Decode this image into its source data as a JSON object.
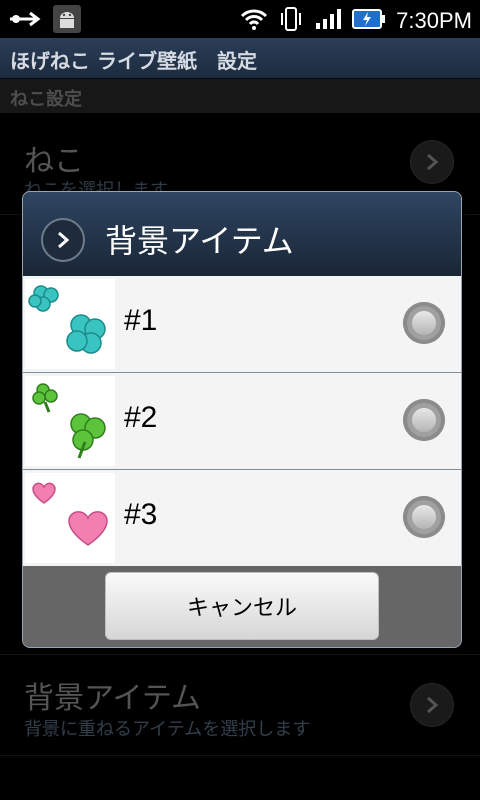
{
  "status_bar": {
    "time": "7:30PM",
    "icons": [
      "usb-icon",
      "android-icon",
      "wifi-icon",
      "vibrate-icon",
      "signal-icon",
      "battery-charging-icon"
    ]
  },
  "app": {
    "title": "ほげねこ ライブ壁紙　設定"
  },
  "section": {
    "header": "ねこ設定"
  },
  "preferences": [
    {
      "title": "ねこ",
      "summary": "ねこを選択します"
    },
    {
      "title": "背景アイテム",
      "summary": "背景に重ねるアイテムを選択します"
    }
  ],
  "dialog": {
    "title": "背景アイテム",
    "items": [
      {
        "label": "#1",
        "thumb": "blue-clover-icon",
        "selected": false
      },
      {
        "label": "#2",
        "thumb": "green-clover-icon",
        "selected": false
      },
      {
        "label": "#3",
        "thumb": "pink-heart-icon",
        "selected": false
      }
    ],
    "cancel_label": "キャンセル"
  },
  "colors": {
    "titlebar": "#2b3e57",
    "dialog_header": "#2f4561",
    "summary_text": "#6d8aa6"
  }
}
